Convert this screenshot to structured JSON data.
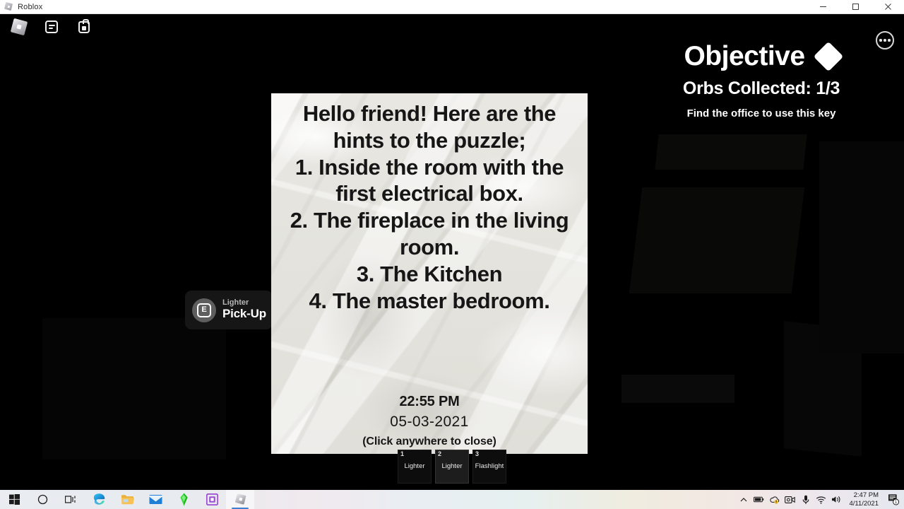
{
  "window": {
    "title": "Roblox",
    "icon": "roblox-icon",
    "controls": [
      {
        "name": "minimize-button",
        "glyph": "—"
      },
      {
        "name": "maximize-button",
        "glyph": "❐"
      },
      {
        "name": "close-button",
        "glyph": "✕"
      }
    ]
  },
  "roblox_topbar": {
    "buttons": [
      {
        "name": "roblox-menu-icon",
        "label": "Roblox Menu"
      },
      {
        "name": "chat-icon",
        "label": "Chat"
      },
      {
        "name": "backpack-icon",
        "label": "Backpack"
      }
    ],
    "more_button": {
      "name": "more-options-icon",
      "label": "More"
    }
  },
  "objective": {
    "title": "Objective",
    "diamond_icon": "diamond-icon",
    "orbs": "Orbs Collected: 1/3",
    "hint": "Find the office to use this key"
  },
  "pickup_prompt": {
    "key": "E",
    "item": "Lighter",
    "action": "Pick-Up"
  },
  "note": {
    "body": "Hello friend! Here are the hints to the puzzle;\n1. Inside the room with the first electrical box.\n2. The fireplace in the living room.\n3. The Kitchen\n4. The master bedroom.",
    "time": "22:55 PM",
    "date": "05-03-2021",
    "close_hint": "(Click anywhere to close)"
  },
  "hotbar": {
    "slots": [
      {
        "number": "1",
        "label": "Lighter",
        "active": false
      },
      {
        "number": "2",
        "label": "Lighter",
        "active": true
      },
      {
        "number": "3",
        "label": "Flashlight",
        "active": false
      }
    ]
  },
  "taskbar": {
    "buttons": [
      {
        "name": "start-button",
        "label": "Start"
      },
      {
        "name": "cortana-search-icon",
        "label": "Search"
      },
      {
        "name": "task-view-icon",
        "label": "Task View"
      },
      {
        "name": "edge-icon",
        "label": "Microsoft Edge"
      },
      {
        "name": "file-explorer-icon",
        "label": "File Explorer"
      },
      {
        "name": "mail-icon",
        "label": "Mail"
      },
      {
        "name": "sims-icon",
        "label": "The Sims"
      },
      {
        "name": "purple-app-icon",
        "label": "App"
      },
      {
        "name": "roblox-taskbar-icon",
        "label": "Roblox"
      }
    ],
    "tray": [
      {
        "name": "show-hidden-icons-chevron",
        "label": "Show hidden icons"
      },
      {
        "name": "battery-icon",
        "label": "Battery"
      },
      {
        "name": "onedrive-icon",
        "label": "OneDrive"
      },
      {
        "name": "camera-icon",
        "label": "Camera"
      },
      {
        "name": "microphone-icon",
        "label": "Microphone"
      },
      {
        "name": "wifi-icon",
        "label": "Network"
      },
      {
        "name": "volume-icon",
        "label": "Volume"
      }
    ],
    "clock": {
      "time": "2:47 PM",
      "date": "4/11/2021"
    },
    "notifications": {
      "name": "notification-icon",
      "count": "1"
    }
  },
  "colors": {
    "paper": "#e9e8e3",
    "ink": "#161616",
    "hud_white": "#ffffff",
    "taskbar_accent": "#3f7fd1"
  }
}
